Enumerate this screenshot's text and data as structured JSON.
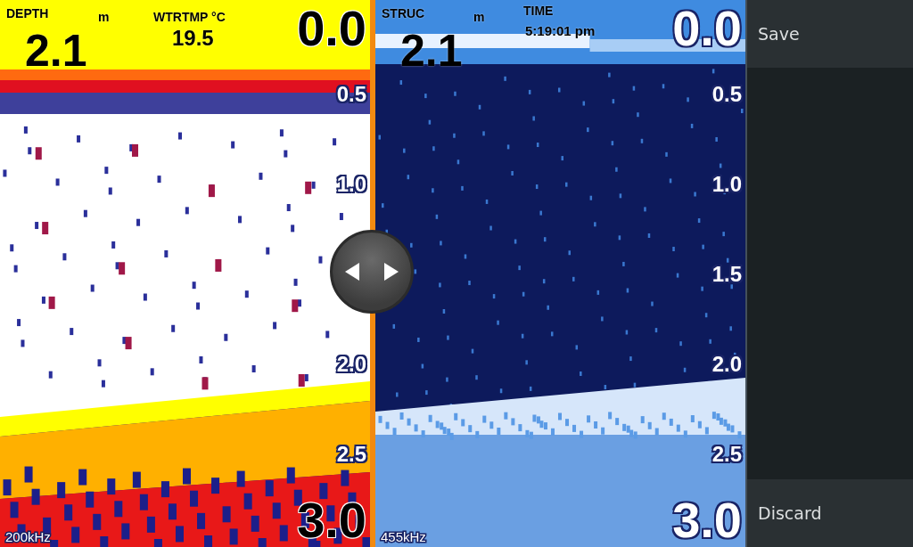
{
  "panes": [
    {
      "kind": "fish",
      "primary": {
        "label": "DEPTH",
        "unit": "m",
        "value": "2.1"
      },
      "secondary": {
        "label": "WTRTMP °C",
        "value": "19.5"
      },
      "scale": [
        "0.0",
        "0.5",
        "1.0",
        "2.0",
        "2.5",
        "3.0"
      ],
      "frequency": "200kHz"
    },
    {
      "kind": "structure",
      "primary": {
        "label": "STRUC",
        "unit": "m",
        "value": "2.1"
      },
      "secondary": {
        "label": "TIME",
        "value": "5:19:01 pm"
      },
      "scale": [
        "0.0",
        "0.5",
        "1.0",
        "1.5",
        "2.0",
        "2.5",
        "3.0"
      ],
      "frequency": "455kHz"
    }
  ],
  "menu": [
    {
      "label": "Save"
    },
    {
      "label": "Discard"
    }
  ]
}
